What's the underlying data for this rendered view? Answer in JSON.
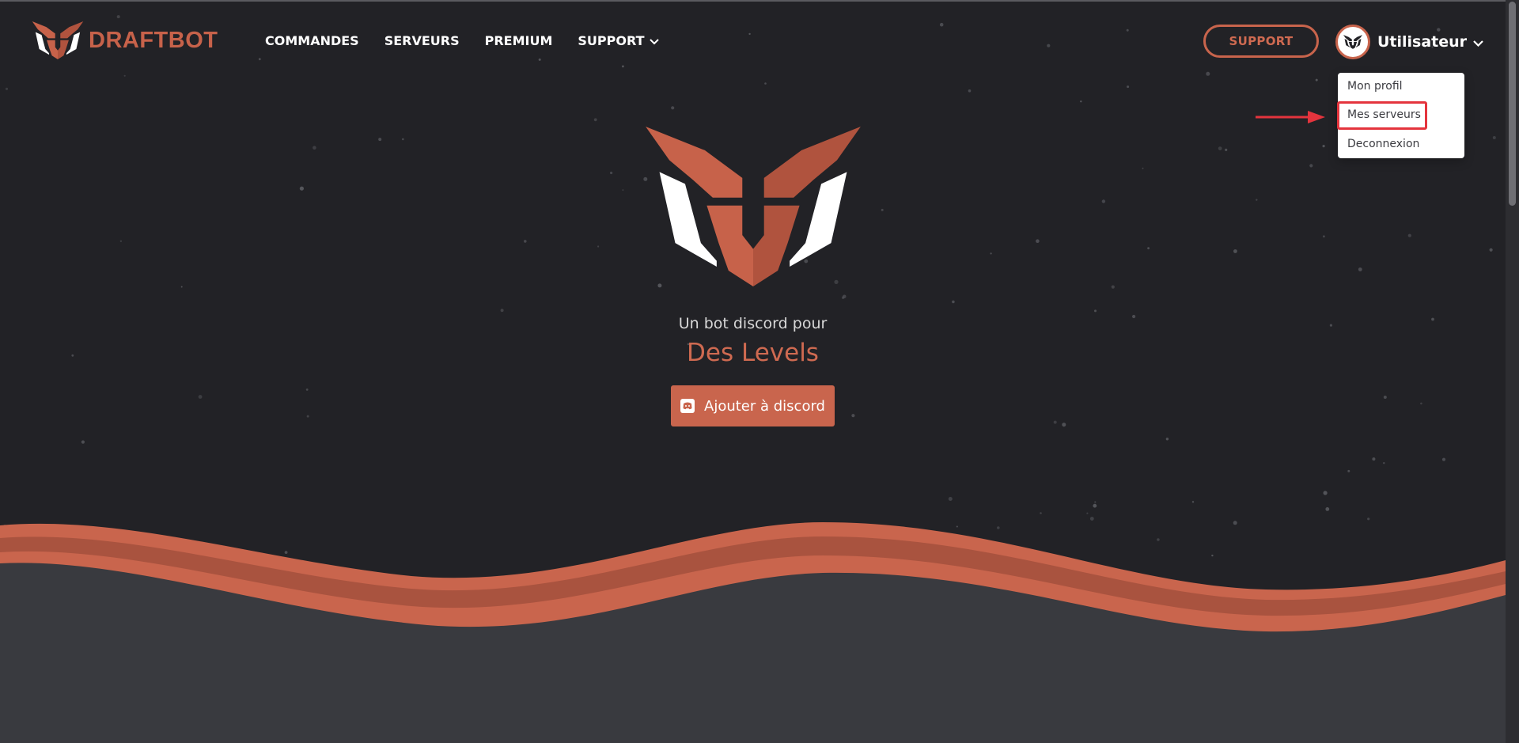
{
  "brand": {
    "name": "DRAFTBOT",
    "icon": "draftbot-logo"
  },
  "nav": [
    {
      "label": "COMMANDES"
    },
    {
      "label": "SERVEURS"
    },
    {
      "label": "PREMIUM"
    },
    {
      "label": "SUPPORT",
      "icon": "chevron-down-icon"
    }
  ],
  "header": {
    "support_label": "SUPPORT",
    "username": "Utilisateur"
  },
  "user_menu": {
    "items": [
      {
        "label": "Mon profil"
      },
      {
        "label": "Mes serveurs",
        "highlighted": true
      },
      {
        "label": "Deconnexion"
      }
    ]
  },
  "hero": {
    "tagline": "Un bot discord pour",
    "rotating_text": "Des Levels",
    "add_button_label": "Ajouter à discord",
    "add_button_icon": "discord-icon"
  },
  "colors": {
    "accent": "#c9654d",
    "background": "#222226",
    "lower_background": "#393a3f",
    "annotation": "#e4343d"
  }
}
